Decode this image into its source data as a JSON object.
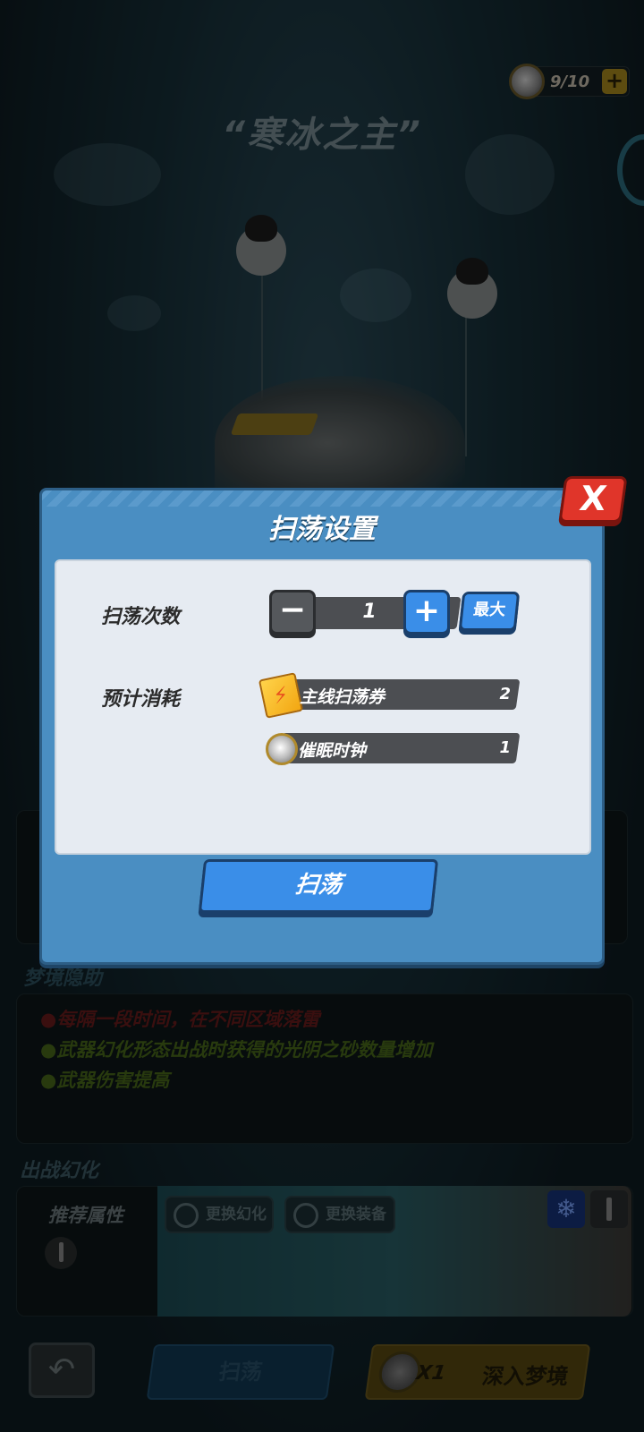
{
  "top": {
    "currency_value": "9/10",
    "currency_plus": "+",
    "boss_title": "“寒冰之主”"
  },
  "page": {
    "affixes_title": "梦境隐助",
    "affixes": [
      {
        "text": "●每隔一段时间，在不同区域落雷",
        "color": "red"
      },
      {
        "text": "●武器幻化形态出战时获得的光阴之砂数量增加",
        "color": "green"
      },
      {
        "text": "●武器伤害提高",
        "color": "green"
      }
    ],
    "deploy_title": "出战幻化",
    "recommended_label": "推荐属性",
    "swap_illusion": "更换幻化",
    "swap_equipment": "更换装备",
    "snow_badge": "❄"
  },
  "bottom": {
    "back_icon": "↶",
    "sweep_label": "扫荡",
    "deep_count": "X1",
    "deep_label": "深入梦境"
  },
  "modal": {
    "title": "扫荡设置",
    "close": "X",
    "count_label": "扫荡次数",
    "minus": "−",
    "plus": "+",
    "count_value": "1",
    "max_label": "最大",
    "cost_label": "预计消耗",
    "costs": [
      {
        "name": "主线扫荡券",
        "amount": "2",
        "icon": "ticket-icon"
      },
      {
        "name": "催眠时钟",
        "amount": "1",
        "icon": "clock-icon"
      }
    ],
    "sweep_button": "扫荡"
  },
  "colors": {
    "modal_bg": "#4a8ec2",
    "primary_button": "#3a8ee8",
    "close_button": "#e0352a",
    "affix_red": "#6a1c1c",
    "affix_green": "#4a6a1a"
  }
}
